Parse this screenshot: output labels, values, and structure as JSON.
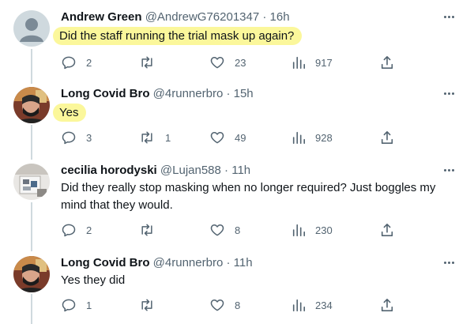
{
  "tweets": [
    {
      "name": "Andrew Green",
      "handle": "@AndrewG76201347",
      "dot": "·",
      "time": "16h",
      "text": "Did the staff running the trial mask up again?",
      "avatar": "default-avatar",
      "highlight": true,
      "reply_count": "2",
      "retweet_count": "",
      "like_count": "23",
      "view_count": "917"
    },
    {
      "name": "Long Covid Bro",
      "handle": "@4runnerbro",
      "dot": "·",
      "time": "15h",
      "text": "Yes",
      "avatar": "masked-man-photo",
      "highlight": true,
      "reply_count": "3",
      "retweet_count": "1",
      "like_count": "49",
      "view_count": "928"
    },
    {
      "name": "cecilia horodyski",
      "handle": "@Lujan588",
      "dot": "·",
      "time": "11h",
      "text": "Did they really stop masking when no longer required? Just boggles my mind that they would.",
      "avatar": "cecilia-photo",
      "highlight": false,
      "reply_count": "2",
      "retweet_count": "",
      "like_count": "8",
      "view_count": "230"
    },
    {
      "name": "Long Covid Bro",
      "handle": "@4runnerbro",
      "dot": "·",
      "time": "11h",
      "text": "Yes they did",
      "avatar": "masked-man-photo",
      "highlight": false,
      "reply_count": "1",
      "retweet_count": "",
      "like_count": "8",
      "view_count": "234"
    }
  ],
  "icons": {
    "reply": "reply-icon",
    "retweet": "retweet-icon",
    "like": "heart-icon",
    "views": "views-icon",
    "share": "share-icon",
    "more": "more-icon"
  },
  "colors": {
    "highlight": "#fbf79b",
    "secondary_text": "#536471",
    "thread_line": "#cfd9de"
  }
}
